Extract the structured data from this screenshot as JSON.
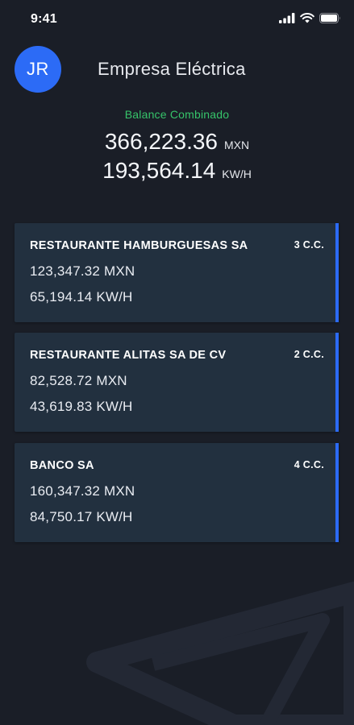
{
  "status_bar": {
    "time": "9:41"
  },
  "header": {
    "avatar_initials": "JR",
    "company_name": "Empresa Eléctrica"
  },
  "balance": {
    "label": "Balance Combinado",
    "amount_money": "366,223.36",
    "money_unit": "MXN",
    "amount_energy": "193,564.14",
    "energy_unit": "KW/H"
  },
  "accounts": [
    {
      "name": "RESTAURANTE HAMBURGUESAS SA",
      "cc": "3 C.C.",
      "money": "123,347.32 MXN",
      "energy": "65,194.14 KW/H"
    },
    {
      "name": "RESTAURANTE ALITAS SA DE CV",
      "cc": "2 C.C.",
      "money": "82,528.72 MXN",
      "energy": "43,619.83 KW/H"
    },
    {
      "name": "BANCO SA",
      "cc": "4 C.C.",
      "money": "160,347.32 MXN",
      "energy": "84,750.17 KW/H"
    }
  ],
  "colors": {
    "background": "#1a1e27",
    "card": "#22303f",
    "accent_blue": "#2c6bf6",
    "balance_label_green": "#36c46a"
  },
  "icons": [
    "signal-icon",
    "wifi-icon",
    "battery-icon",
    "logo-watermark-icon"
  ]
}
